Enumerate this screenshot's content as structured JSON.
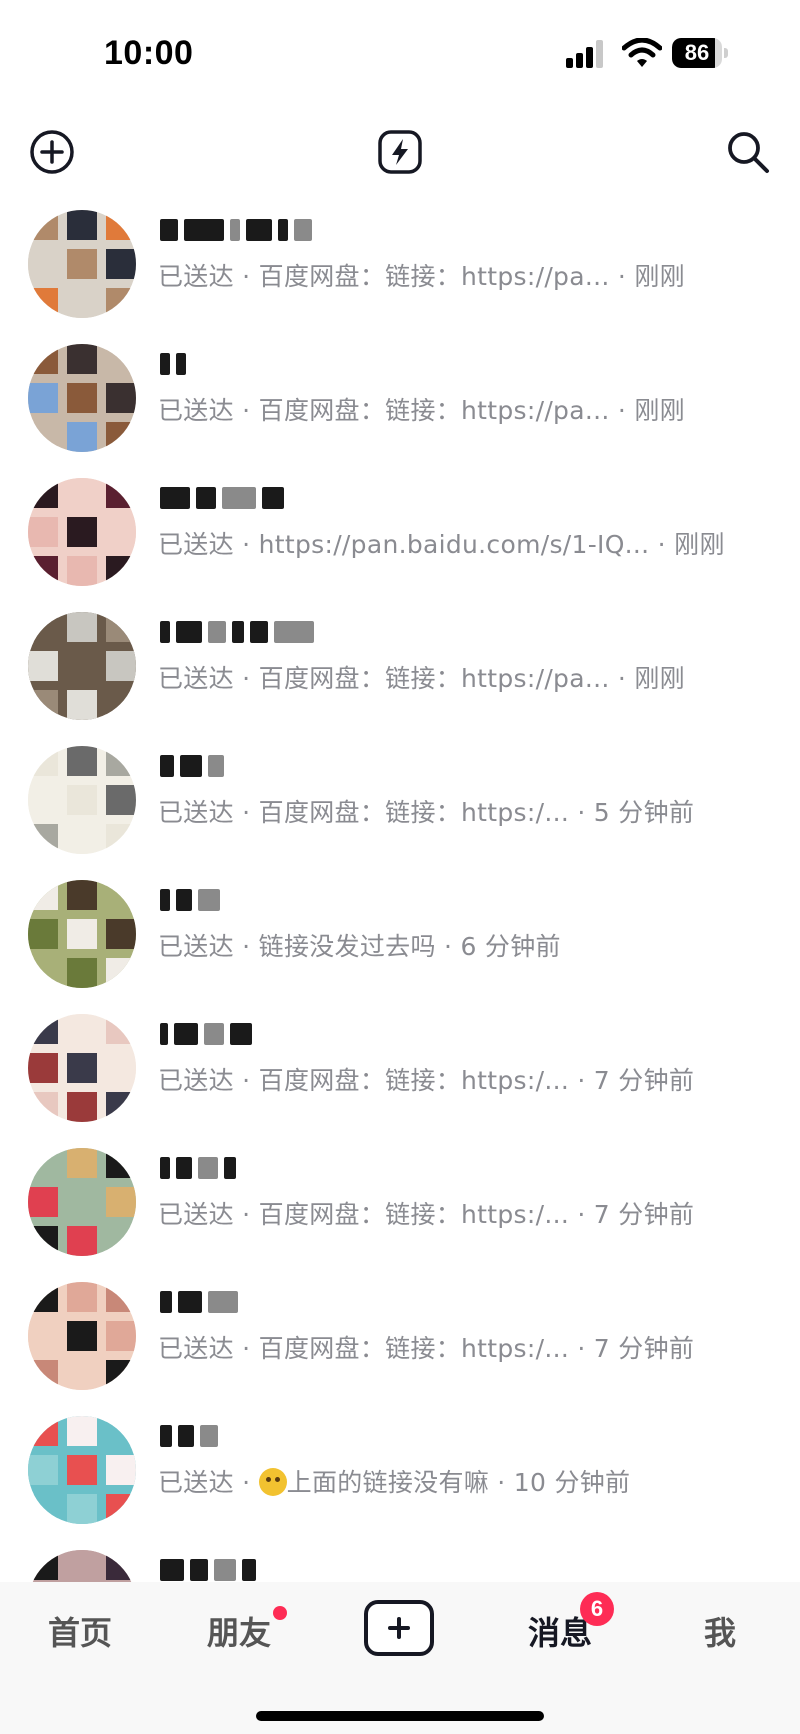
{
  "status_bar": {
    "time": "10:00",
    "battery": {
      "label": "86",
      "level": 0.86
    },
    "icons": [
      "signal-icon",
      "wifi-icon",
      "battery-icon"
    ]
  },
  "toolbar": {
    "icons": [
      "add-circle-icon",
      "flash-icon",
      "search-icon"
    ]
  },
  "conversations": [
    {
      "preview": "已送达 · 百度网盘：链接：https://pa...  · 刚刚",
      "avatar_colors": [
        "#b08a6a",
        "#2a2e3a",
        "#e07a3a",
        "#d9d2c8"
      ]
    },
    {
      "preview": "已送达 · 百度网盘：链接：https://pa...  · 刚刚",
      "avatar_colors": [
        "#7aa3d6",
        "#8a5a3a",
        "#3a3030",
        "#c8b8a8"
      ]
    },
    {
      "preview": "已送达 · https://pan.baidu.com/s/1-IQ... · 刚刚",
      "avatar_colors": [
        "#5a2030",
        "#e8b8b0",
        "#2a1a20",
        "#f0d0c8"
      ]
    },
    {
      "preview": "已送达 · 百度网盘：链接：https://pa...  · 刚刚",
      "avatar_colors": [
        "#c8c6c0",
        "#9a8a78",
        "#e0ded8",
        "#6a5a4a"
      ]
    },
    {
      "preview": "已送达 · 百度网盘：链接：https:/...  · 5 分钟前",
      "avatar_colors": [
        "#eae6da",
        "#6a6a6a",
        "#a8a8a0",
        "#f2efe6"
      ]
    },
    {
      "preview": "已送达 · 链接没发过去吗 · 6 分钟前",
      "avatar_colors": [
        "#6a7a3a",
        "#f0ece6",
        "#4a3a2a",
        "#a8b078"
      ]
    },
    {
      "preview": "已送达 · 百度网盘：链接：https:/...  · 7 分钟前",
      "avatar_colors": [
        "#e8c8c0",
        "#9a3a3a",
        "#3a3a4a",
        "#f4e8e0"
      ]
    },
    {
      "preview": "已送达 · 百度网盘：链接：https:/...  · 7 分钟前",
      "avatar_colors": [
        "#d8b070",
        "#1a1a1a",
        "#e04050",
        "#a0b8a0"
      ]
    },
    {
      "preview": "已送达 · 百度网盘：链接：https:/...  · 7 分钟前",
      "avatar_colors": [
        "#1a1a1a",
        "#e0a898",
        "#c88878",
        "#f0d0c0"
      ]
    },
    {
      "preview_prefix": "已送达 · ",
      "preview_suffix": "上面的链接没有嘛 · 10 分钟前",
      "emoji": "thinking-face-icon",
      "avatar_colors": [
        "#8ed0d4",
        "#e85050",
        "#f8f0f0",
        "#6ac0c8"
      ]
    },
    {
      "preview": "",
      "avatar_colors": [
        "#3a2a3a",
        "#f0e0e0",
        "#1a1a1a",
        "#c0a0a0"
      ]
    }
  ],
  "bottom_nav": {
    "home": "首页",
    "friends": "朋友",
    "create_icon": "plus-square-icon",
    "messages": "消息",
    "messages_badge": "6",
    "me": "我"
  },
  "colors": {
    "badge": "#fe2c55",
    "text_secondary": "#8a8b91",
    "text_primary": "#161823"
  }
}
